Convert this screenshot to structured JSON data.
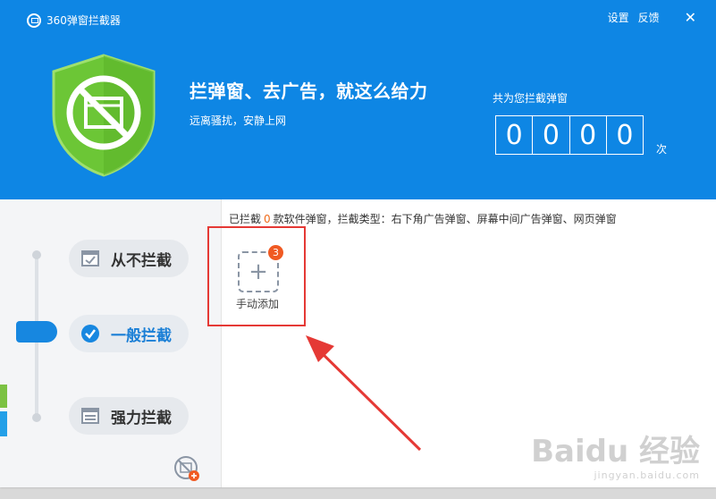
{
  "app": {
    "title": "360弹窗拦截器"
  },
  "topnav": {
    "settings": "设置",
    "feedback": "反馈"
  },
  "hero": {
    "headline": "拦弹窗、去广告，就这么给力",
    "subline": "远离骚扰，安静上网"
  },
  "counter": {
    "label": "共为您拦截弹窗",
    "digits": [
      "0",
      "0",
      "0",
      "0"
    ],
    "unit": "次"
  },
  "modes": [
    {
      "label": "从不拦截",
      "icon": "check-square-icon",
      "selected": false
    },
    {
      "label": "一般拦截",
      "icon": "check-circle-icon",
      "selected": true
    },
    {
      "label": "强力拦截",
      "icon": "window-list-icon",
      "selected": false
    }
  ],
  "info": {
    "prefix": "已拦截",
    "count": "0",
    "suffix": "款软件弹窗，拦截类型：右下角广告弹窗、屏幕中间广告弹窗、网页弹窗"
  },
  "add": {
    "label": "手动添加",
    "badge": "3"
  },
  "colors": {
    "header": "#0e86e4",
    "accent": "#1787e0",
    "highlight": "#e53935",
    "count": "#f06a19"
  },
  "watermark": {
    "main": "Baidu 经验",
    "sub": "jingyan.baidu.com"
  }
}
